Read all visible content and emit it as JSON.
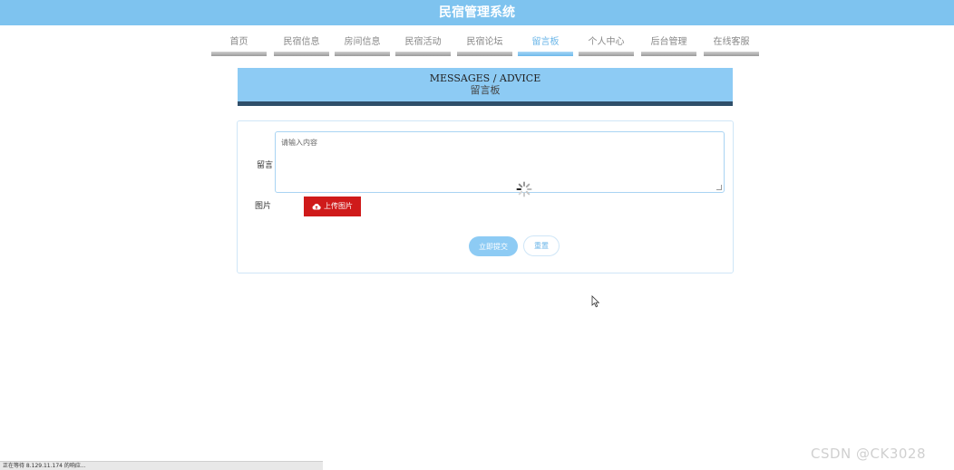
{
  "header": {
    "title": "民宿管理系统"
  },
  "nav": {
    "items": [
      {
        "label": "首页"
      },
      {
        "label": "民宿信息"
      },
      {
        "label": "房间信息"
      },
      {
        "label": "民宿活动"
      },
      {
        "label": "民宿论坛"
      },
      {
        "label": "留言板",
        "active": true
      },
      {
        "label": "个人中心"
      },
      {
        "label": "后台管理"
      },
      {
        "label": "在线客服"
      }
    ]
  },
  "banner": {
    "title_en": "MESSAGES / ADVICE",
    "title_cn": "留言板"
  },
  "form": {
    "message_label": "留言",
    "message_placeholder": "请输入内容",
    "image_label": "图片",
    "upload_label": "上传图片",
    "submit_label": "立即提交",
    "reset_label": "重置"
  },
  "status": {
    "text": "正在等待 8.129.11.174 的响应..."
  },
  "watermark": {
    "text": "CSDN @CK3028"
  },
  "colors": {
    "header": "#7ec3ef",
    "accent": "#8dcbf4",
    "banner_border": "#2f4f6a",
    "upload": "#cf1a1a"
  }
}
